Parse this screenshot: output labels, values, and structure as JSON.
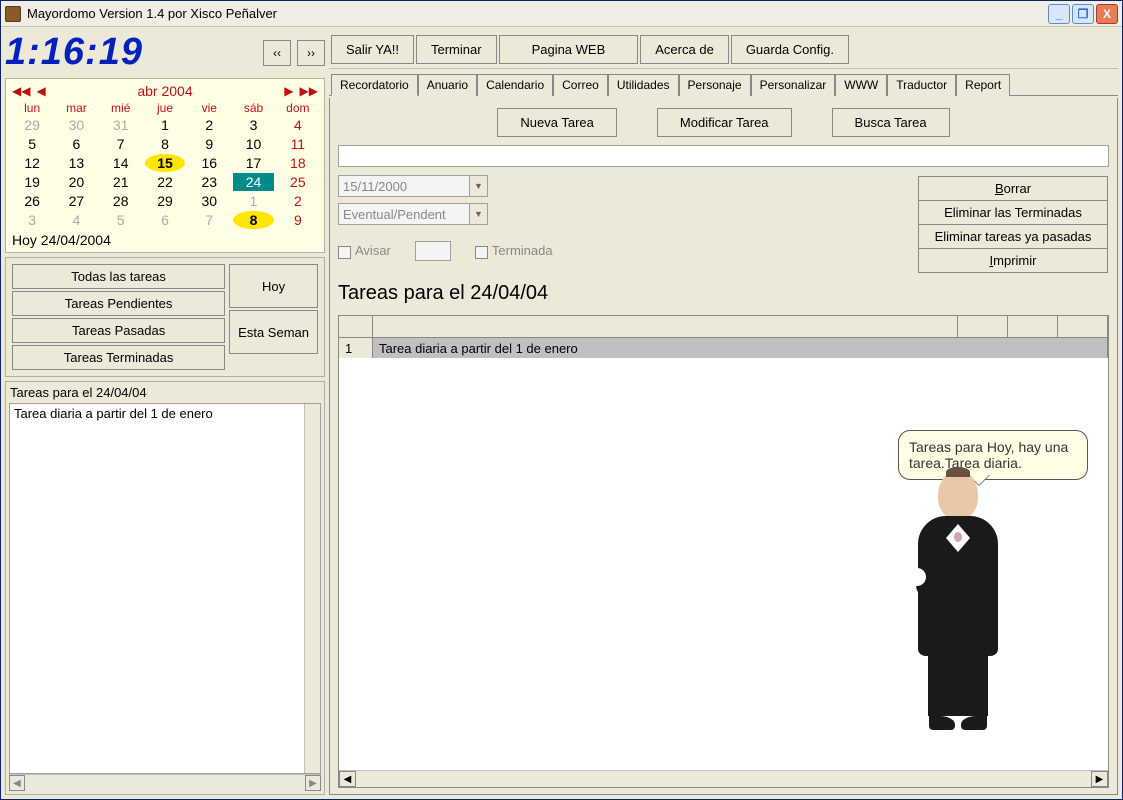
{
  "window": {
    "title": "Mayordomo Version 1.4  por Xisco Peñalver"
  },
  "clock": "1:16:19",
  "nav": {
    "prev": "‹‹",
    "next": "››"
  },
  "calendar": {
    "month_label": "abr 2004",
    "dow": [
      "lun",
      "mar",
      "mié",
      "jue",
      "vie",
      "sáb",
      "dom"
    ],
    "cells": [
      {
        "n": "29",
        "cls": "grey"
      },
      {
        "n": "30",
        "cls": "grey"
      },
      {
        "n": "31",
        "cls": "grey"
      },
      {
        "n": "1",
        "cls": ""
      },
      {
        "n": "2",
        "cls": ""
      },
      {
        "n": "3",
        "cls": ""
      },
      {
        "n": "4",
        "cls": "sunred"
      },
      {
        "n": "5",
        "cls": ""
      },
      {
        "n": "6",
        "cls": ""
      },
      {
        "n": "7",
        "cls": ""
      },
      {
        "n": "8",
        "cls": ""
      },
      {
        "n": "9",
        "cls": ""
      },
      {
        "n": "10",
        "cls": ""
      },
      {
        "n": "11",
        "cls": "sunred"
      },
      {
        "n": "12",
        "cls": ""
      },
      {
        "n": "13",
        "cls": ""
      },
      {
        "n": "14",
        "cls": ""
      },
      {
        "n": "15",
        "cls": "hlyellow"
      },
      {
        "n": "16",
        "cls": ""
      },
      {
        "n": "17",
        "cls": ""
      },
      {
        "n": "18",
        "cls": "sunred"
      },
      {
        "n": "19",
        "cls": ""
      },
      {
        "n": "20",
        "cls": ""
      },
      {
        "n": "21",
        "cls": ""
      },
      {
        "n": "22",
        "cls": ""
      },
      {
        "n": "23",
        "cls": ""
      },
      {
        "n": "24",
        "cls": "hlteal"
      },
      {
        "n": "25",
        "cls": "sunred"
      },
      {
        "n": "26",
        "cls": ""
      },
      {
        "n": "27",
        "cls": ""
      },
      {
        "n": "28",
        "cls": ""
      },
      {
        "n": "29",
        "cls": ""
      },
      {
        "n": "30",
        "cls": ""
      },
      {
        "n": "1",
        "cls": "grey"
      },
      {
        "n": "2",
        "cls": "grey sunred"
      },
      {
        "n": "3",
        "cls": "grey"
      },
      {
        "n": "4",
        "cls": "grey"
      },
      {
        "n": "5",
        "cls": "grey"
      },
      {
        "n": "6",
        "cls": "grey"
      },
      {
        "n": "7",
        "cls": "grey"
      },
      {
        "n": "8",
        "cls": "hlyellow"
      },
      {
        "n": "9",
        "cls": "grey sunred"
      }
    ],
    "today_label": "Hoy 24/04/2004"
  },
  "left_buttons": {
    "todas": "Todas las tareas",
    "pendientes": "Tareas Pendientes",
    "pasadas": "Tareas Pasadas",
    "terminadas": "Tareas Terminadas",
    "hoy": "Hoy",
    "semana": "Esta Seman"
  },
  "left_list": {
    "title": "Tareas para el 24/04/04",
    "item1": "Tarea diaria a partir del 1 de enero"
  },
  "top_buttons": {
    "salir": "Salir YA!!",
    "terminar": "Terminar",
    "web": "Pagina WEB",
    "acerca": "Acerca de",
    "guarda": "Guarda Config."
  },
  "tabs": [
    "Recordatorio",
    "Anuario",
    "Calendario",
    "Correo",
    "Utilidades",
    "Personaje",
    "Personalizar",
    "WWW",
    "Traductor",
    "Report"
  ],
  "actions": {
    "nueva": "Nueva Tarea",
    "modificar": "Modificar Tarea",
    "busca": "Busca Tarea"
  },
  "combo_date": "15/11/2000",
  "combo_type": "Eventual/Pendent",
  "check_avisar": "Avisar",
  "check_terminada": "Terminada",
  "right_buttons": {
    "borrar": "Borrar",
    "eliminar_term": "Eliminar las Terminadas",
    "eliminar_pas": "Eliminar tareas ya pasadas",
    "imprimir": "Imprimir"
  },
  "grid_header": "Tareas para el 24/04/04",
  "grid_row": {
    "num": "1",
    "text": "Tarea diaria a partir del 1 de enero"
  },
  "speech": "Tareas para Hoy, hay una tarea.Tarea diaria."
}
